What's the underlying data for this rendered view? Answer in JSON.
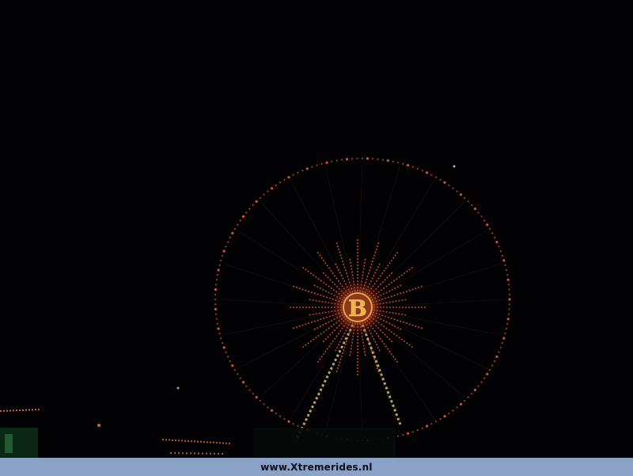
{
  "watermark": {
    "text": "www.Xtremerides.nl",
    "bar_color": "#8aa1c8"
  },
  "scene": {
    "subject": "ferris wheel at night",
    "hub_letter": "B",
    "light_color": "#e0523a",
    "hub_color": "#e8a030"
  }
}
